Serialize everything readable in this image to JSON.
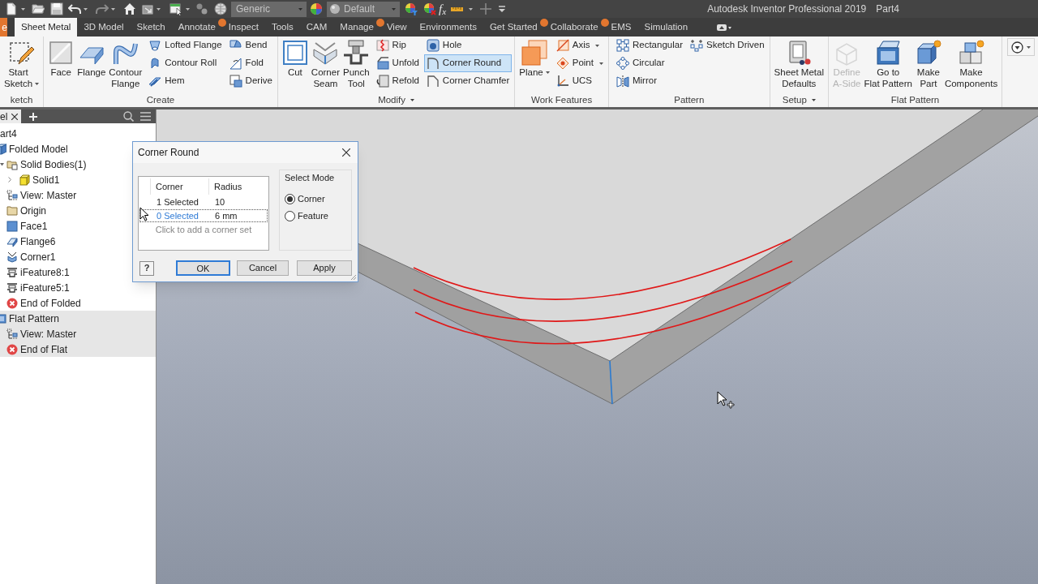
{
  "title_bar": {
    "style_dropdown": "Generic",
    "appearance_dropdown": "Default",
    "parameters_button": "f$_{x}$",
    "title": "Autodesk Inventor Professional 2019",
    "document": "Part4"
  },
  "file_tab": {
    "label": "e"
  },
  "ribbon_tabs": [
    {
      "label": "Sheet Metal",
      "selected": true,
      "notification": false
    },
    {
      "label": "3D Model",
      "selected": false,
      "notification": false
    },
    {
      "label": "Sketch",
      "selected": false,
      "notification": false
    },
    {
      "label": "Annotate",
      "selected": false,
      "notification": true
    },
    {
      "label": "Inspect",
      "selected": false,
      "notification": false
    },
    {
      "label": "Tools",
      "selected": false,
      "notification": false
    },
    {
      "label": "CAM",
      "selected": false,
      "notification": false
    },
    {
      "label": "Manage",
      "selected": false,
      "notification": true
    },
    {
      "label": "View",
      "selected": false,
      "notification": false
    },
    {
      "label": "Environments",
      "selected": false,
      "notification": false
    },
    {
      "label": "Get Started",
      "selected": false,
      "notification": true
    },
    {
      "label": "Collaborate",
      "selected": false,
      "notification": true
    },
    {
      "label": "EMS",
      "selected": false,
      "notification": false
    },
    {
      "label": "Simulation",
      "selected": false,
      "notification": false
    }
  ],
  "ribbon_panels": [
    {
      "title": "ketch",
      "has_menu": false,
      "large_tools": [
        {
          "label": "Start\nSketch",
          "has_menu": true,
          "selected": false,
          "disabled": false
        }
      ]
    },
    {
      "title": "Create",
      "has_menu": false,
      "large_tools": [
        {
          "label": "Face",
          "has_menu": false,
          "selected": false,
          "disabled": false
        },
        {
          "label": "Flange",
          "has_menu": false,
          "selected": false,
          "disabled": false
        },
        {
          "label": "Contour\nFlange",
          "has_menu": false,
          "selected": false,
          "disabled": false
        }
      ],
      "small_columns": [
        [
          {
            "label": "Lofted Flange",
            "has_menu": false,
            "selected": false,
            "disabled": false
          },
          {
            "label": "Contour Roll",
            "has_menu": false,
            "selected": false,
            "disabled": false
          },
          {
            "label": "Hem",
            "has_menu": false,
            "selected": false,
            "disabled": false
          }
        ],
        [
          {
            "label": "Bend",
            "has_menu": false,
            "selected": false,
            "disabled": false
          },
          {
            "label": "Fold",
            "has_menu": false,
            "selected": false,
            "disabled": false
          },
          {
            "label": "Derive",
            "has_menu": false,
            "selected": false,
            "disabled": false
          }
        ]
      ]
    },
    {
      "title": "Modify",
      "has_menu": true,
      "large_tools": [
        {
          "label": "Cut",
          "has_menu": false,
          "selected": false,
          "disabled": false
        },
        {
          "label": "Corner\nSeam",
          "has_menu": false,
          "selected": false,
          "disabled": false
        },
        {
          "label": "Punch\nTool",
          "has_menu": false,
          "selected": false,
          "disabled": false
        }
      ],
      "small_columns": [
        [
          {
            "label": "Rip",
            "has_menu": false,
            "selected": false,
            "disabled": false
          },
          {
            "label": "Unfold",
            "has_menu": false,
            "selected": false,
            "disabled": false
          },
          {
            "label": "Refold",
            "has_menu": false,
            "selected": false,
            "disabled": false
          }
        ],
        [
          {
            "label": "Hole",
            "has_menu": false,
            "selected": false,
            "disabled": false
          },
          {
            "label": "Corner Round",
            "has_menu": false,
            "selected": true,
            "disabled": false
          },
          {
            "label": "Corner Chamfer",
            "has_menu": false,
            "selected": false,
            "disabled": false
          }
        ]
      ]
    },
    {
      "title": "Work Features",
      "has_menu": false,
      "large_tools": [
        {
          "label": "Plane",
          "has_menu": true,
          "selected": false,
          "disabled": false
        }
      ],
      "small_columns": [
        [
          {
            "label": "Axis",
            "has_menu": true,
            "selected": false,
            "disabled": false
          },
          {
            "label": "Point",
            "has_menu": true,
            "selected": false,
            "disabled": false
          },
          {
            "label": "UCS",
            "has_menu": false,
            "selected": false,
            "disabled": false
          }
        ]
      ]
    },
    {
      "title": "Pattern",
      "has_menu": false,
      "small_columns": [
        [
          {
            "label": "Rectangular",
            "has_menu": false,
            "selected": false,
            "disabled": false
          },
          {
            "label": "Circular",
            "has_menu": false,
            "selected": false,
            "disabled": false
          },
          {
            "label": "Mirror",
            "has_menu": false,
            "selected": false,
            "disabled": false
          }
        ],
        [
          {
            "label": "Sketch Driven",
            "has_menu": false,
            "selected": false,
            "disabled": false
          }
        ]
      ]
    },
    {
      "title": "Setup",
      "has_menu": true,
      "large_tools": [
        {
          "label": "Sheet Metal\nDefaults",
          "has_menu": false,
          "selected": false,
          "disabled": false
        }
      ]
    },
    {
      "title": "Flat Pattern",
      "has_menu": false,
      "large_tools": [
        {
          "label": "Define\nA-Side",
          "has_menu": false,
          "selected": false,
          "disabled": true
        },
        {
          "label": "Go to\nFlat Pattern",
          "has_menu": false,
          "selected": false,
          "disabled": false
        },
        {
          "label": "Make\nPart",
          "has_menu": false,
          "selected": false,
          "disabled": false
        },
        {
          "label": "Make\nComponents",
          "has_menu": false,
          "selected": false,
          "disabled": false
        }
      ]
    }
  ],
  "browser": {
    "tab": "el",
    "root": "art4",
    "tree": [
      {
        "label": "Folded Model",
        "kind": "folded_model",
        "highlighted": false,
        "children": [
          {
            "label": "Solid Bodies(1)",
            "kind": "solid_bodies",
            "children": [
              {
                "label": "Solid1",
                "kind": "solid",
                "collapsed": true
              }
            ]
          },
          {
            "label": "View: Master",
            "kind": "view"
          },
          {
            "label": "Origin",
            "kind": "origin"
          },
          {
            "label": "Face1",
            "kind": "face"
          },
          {
            "label": "Flange6",
            "kind": "flange"
          },
          {
            "label": "Corner1",
            "kind": "corner"
          },
          {
            "label": "iFeature8:1",
            "kind": "ifeature"
          },
          {
            "label": "iFeature5:1",
            "kind": "ifeature"
          },
          {
            "label": "End of Folded",
            "kind": "end"
          }
        ]
      },
      {
        "label": "Flat Pattern",
        "kind": "flat_pattern",
        "highlighted": true,
        "children": [
          {
            "label": "View: Master",
            "kind": "view"
          },
          {
            "label": "End of Flat",
            "kind": "end"
          }
        ]
      }
    ]
  },
  "dialog": {
    "title": "Corner Round",
    "table": {
      "columns": [
        "Corner",
        "Radius"
      ],
      "rows": [
        {
          "corner": "1 Selected",
          "radius": "10",
          "selected": false
        },
        {
          "corner": "0 Selected",
          "radius": "6 mm",
          "selected": true
        }
      ],
      "add_row_hint": "Click to add a corner set"
    },
    "select_mode": {
      "label": "Select Mode",
      "options": [
        {
          "label": "Corner",
          "selected": true
        },
        {
          "label": "Feature",
          "selected": false
        }
      ]
    },
    "help_button": "?",
    "buttons": [
      {
        "label": "OK",
        "default": true
      },
      {
        "label": "Cancel",
        "default": false
      },
      {
        "label": "Apply",
        "default": false
      }
    ]
  }
}
